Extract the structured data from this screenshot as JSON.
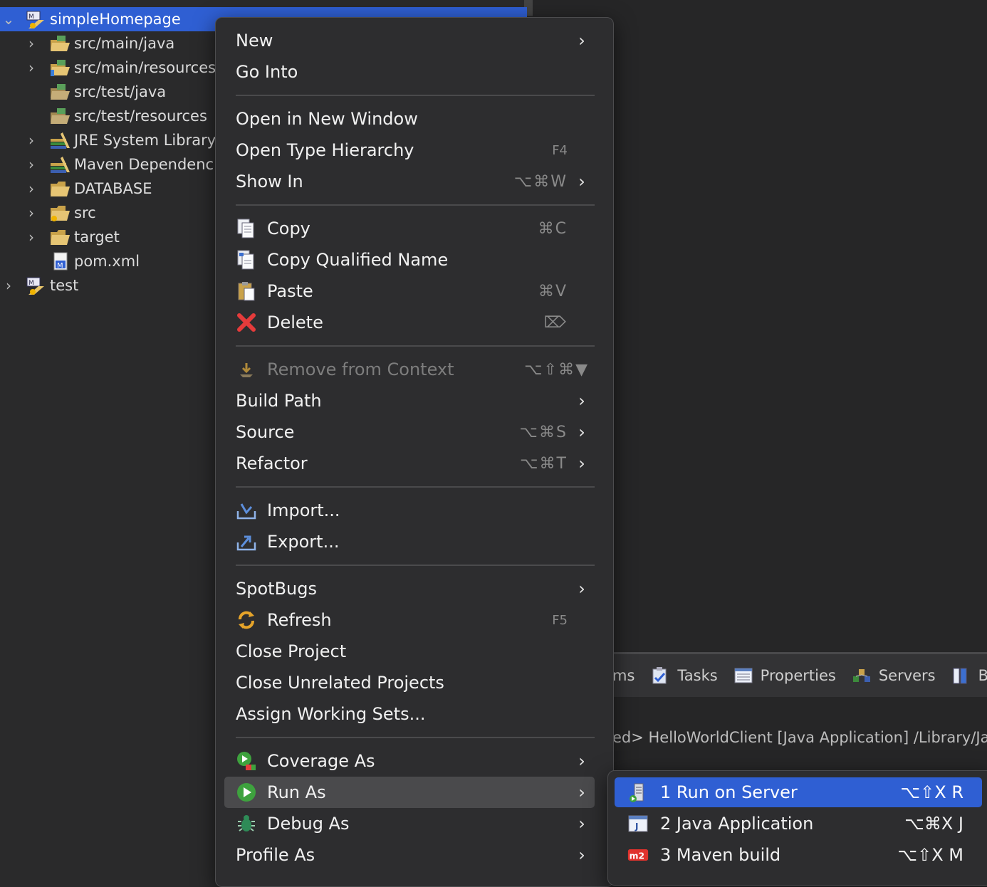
{
  "tree": {
    "items": [
      {
        "label": "simpleHomepage",
        "icon": "maven-project-icon",
        "chevron": "⌄",
        "selected": true
      },
      {
        "label": "src/main/java",
        "icon": "source-folder-icon",
        "chevron": "›"
      },
      {
        "label": "src/main/resources",
        "icon": "source-folder-icon",
        "chevron": "›"
      },
      {
        "label": "src/test/java",
        "icon": "source-folder-icon",
        "chevron": ""
      },
      {
        "label": "src/test/resources",
        "icon": "source-folder-icon",
        "chevron": ""
      },
      {
        "label": "JRE System Library",
        "icon": "library-icon",
        "chevron": "›"
      },
      {
        "label": "Maven Dependencies",
        "icon": "library-icon",
        "chevron": "›"
      },
      {
        "label": "DATABASE",
        "icon": "folder-icon",
        "chevron": "›"
      },
      {
        "label": "src",
        "icon": "folder-icon",
        "chevron": "›"
      },
      {
        "label": "target",
        "icon": "folder-icon",
        "chevron": "›"
      },
      {
        "label": "pom.xml",
        "icon": "maven-pom-icon",
        "chevron": ""
      },
      {
        "label": "test",
        "icon": "maven-project-icon",
        "chevron": "›"
      }
    ]
  },
  "bottom_tabs": [
    {
      "label": "ms",
      "icon": ""
    },
    {
      "label": "Tasks",
      "icon": "tasks-icon"
    },
    {
      "label": "Properties",
      "icon": "properties-icon"
    },
    {
      "label": "Servers",
      "icon": "servers-icon"
    },
    {
      "label": "B",
      "icon": "bookmarks-icon"
    }
  ],
  "console": {
    "line": "ed> HelloWorldClient [Java Application] /Library/Java"
  },
  "context_menu": {
    "items": [
      {
        "label": "New",
        "arrow": "›"
      },
      {
        "label": "Go Into"
      },
      {
        "label": "Open in New Window"
      },
      {
        "label": "Open Type Hierarchy",
        "shortcut": "F4"
      },
      {
        "label": "Show In",
        "shortcut": "⌥⌘W",
        "arrow": "›"
      },
      {
        "label": "Copy",
        "shortcut": "⌘C",
        "icon": "copy-icon"
      },
      {
        "label": "Copy Qualified Name",
        "icon": "copy-qualified-name-icon"
      },
      {
        "label": "Paste",
        "shortcut": "⌘V",
        "icon": "paste-icon"
      },
      {
        "label": "Delete",
        "shortcut": "⌦",
        "icon": "delete-icon"
      },
      {
        "label": "Remove from Context",
        "shortcut": "⌥⇧⌘▼",
        "icon": "remove-context-icon",
        "disabled": true
      },
      {
        "label": "Build Path",
        "arrow": "›"
      },
      {
        "label": "Source",
        "shortcut": "⌥⌘S",
        "arrow": "›"
      },
      {
        "label": "Refactor",
        "shortcut": "⌥⌘T",
        "arrow": "›"
      },
      {
        "label": "Import...",
        "icon": "import-icon"
      },
      {
        "label": "Export...",
        "icon": "export-icon"
      },
      {
        "label": "SpotBugs",
        "arrow": "›"
      },
      {
        "label": "Refresh",
        "shortcut": "F5",
        "icon": "refresh-icon"
      },
      {
        "label": "Close Project"
      },
      {
        "label": "Close Unrelated Projects"
      },
      {
        "label": "Assign Working Sets..."
      },
      {
        "label": "Coverage As",
        "icon": "coverage-icon",
        "arrow": "›"
      },
      {
        "label": "Run As",
        "icon": "run-icon",
        "arrow": "›",
        "hover": true
      },
      {
        "label": "Debug As",
        "icon": "debug-icon",
        "arrow": "›"
      },
      {
        "label": "Profile As",
        "arrow": "›"
      }
    ]
  },
  "run_as_submenu": {
    "items": [
      {
        "label": "1 Run on Server",
        "shortcut": "⌥⇧X R",
        "icon": "server-icon",
        "active": true
      },
      {
        "label": "2 Java Application",
        "shortcut": "⌥⌘X J",
        "icon": "java-app-icon"
      },
      {
        "label": "3 Maven build",
        "shortcut": "⌥⇧X M",
        "icon": "maven-m2-icon"
      }
    ]
  },
  "colors": {
    "selection": "#2f5fd3",
    "menu_bg": "#2d2d2f",
    "background": "#2a2a2b"
  }
}
